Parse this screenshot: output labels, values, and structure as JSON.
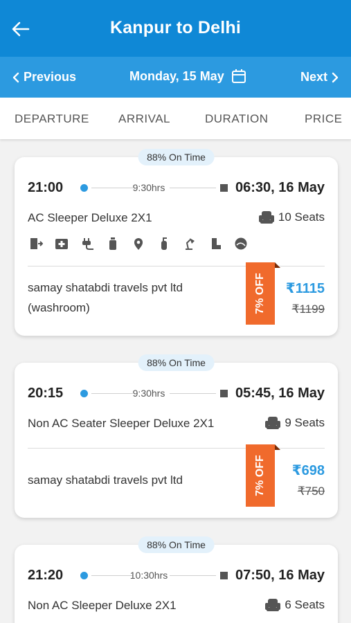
{
  "header": {
    "title": "Kanpur to Delhi",
    "back_icon": "arrow-left-icon"
  },
  "datebar": {
    "prev_label": "Previous",
    "date_label": "Monday, 15 May",
    "next_label": "Next"
  },
  "sort": {
    "departure": "DEPARTURE",
    "arrival": "ARRIVAL",
    "duration": "DURATION",
    "price": "PRICE"
  },
  "buses": [
    {
      "ontime": "88% On Time",
      "departure": "21:00",
      "duration": "9:30hrs",
      "arrival": "06:30, 16 May",
      "bus_type": "AC Sleeper Deluxe 2X1",
      "seats": "10 Seats",
      "amenities": [
        "door-exit-icon",
        "first-aid-icon",
        "charging-plug-icon",
        "water-bottle-icon",
        "location-pin-icon",
        "fire-extinguisher-icon",
        "reading-lamp-icon",
        "pillow-icon",
        "blanket-icon"
      ],
      "operator_line1": "samay shatabdi travels pvt ltd",
      "operator_line2": "(washroom)",
      "discount": "7% OFF",
      "price": "₹1115",
      "old_price": "₹1199"
    },
    {
      "ontime": "88% On Time",
      "departure": "20:15",
      "duration": "9:30hrs",
      "arrival": "05:45, 16 May",
      "bus_type": "Non AC Seater Sleeper Deluxe 2X1",
      "seats": "9 Seats",
      "operator_line1": "samay shatabdi travels pvt ltd",
      "discount": "7% OFF",
      "price": "₹698",
      "old_price": "₹750"
    },
    {
      "ontime": "88% On Time",
      "departure": "21:20",
      "duration": "10:30hrs",
      "arrival": "07:50, 16 May",
      "bus_type": "Non AC Sleeper Deluxe 2X1",
      "seats": "6 Seats"
    }
  ],
  "colors": {
    "header_blue": "#0f88d6",
    "datebar_blue": "#2c9ae0",
    "discount_orange": "#f06a2c",
    "price_blue": "#2c9ae0"
  }
}
